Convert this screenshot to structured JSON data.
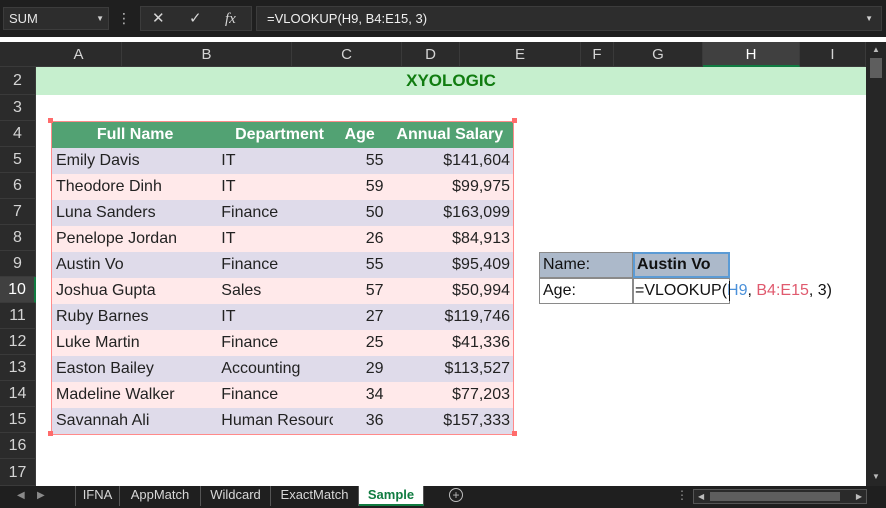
{
  "formula_bar": {
    "name_box": "SUM",
    "formula": "=VLOOKUP(H9, B4:E15, 3)",
    "cancel_glyph": "✕",
    "enter_glyph": "✓",
    "fx_glyph": "fx"
  },
  "columns": [
    "A",
    "B",
    "C",
    "D",
    "E",
    "F",
    "G",
    "H",
    "I"
  ],
  "selected_column": "H",
  "rows": [
    "2",
    "3",
    "4",
    "5",
    "6",
    "7",
    "8",
    "9",
    "10",
    "11",
    "12",
    "13",
    "14",
    "15",
    "16",
    "17"
  ],
  "selected_row": "10",
  "banner": {
    "title": "XYOLOGIC"
  },
  "table": {
    "headers": [
      "Full Name",
      "Department",
      "Age",
      "Annual Salary"
    ],
    "rows": [
      [
        "Emily Davis",
        "IT",
        "55",
        "$141,604"
      ],
      [
        "Theodore Dinh",
        "IT",
        "59",
        "$99,975"
      ],
      [
        "Luna Sanders",
        "Finance",
        "50",
        "$163,099"
      ],
      [
        "Penelope Jordan",
        "IT",
        "26",
        "$84,913"
      ],
      [
        "Austin Vo",
        "Finance",
        "55",
        "$95,409"
      ],
      [
        "Joshua Gupta",
        "Sales",
        "57",
        "$50,994"
      ],
      [
        "Ruby Barnes",
        "IT",
        "27",
        "$119,746"
      ],
      [
        "Luke Martin",
        "Finance",
        "25",
        "$41,336"
      ],
      [
        "Easton Bailey",
        "Accounting",
        "29",
        "$113,527"
      ],
      [
        "Madeline Walker",
        "Finance",
        "34",
        "$77,203"
      ],
      [
        "Savannah Ali",
        "Human Resources",
        "36",
        "$157,333"
      ]
    ]
  },
  "lookup": {
    "name_label": "Name:",
    "name_value": "Austin Vo",
    "age_label": "Age:",
    "formula_prefix": "=VLOOKUP(",
    "formula_ref1": "H9",
    "formula_sep1": ", ",
    "formula_ref2": "B4:E15",
    "formula_suffix": ", 3)"
  },
  "sheet_tabs": {
    "tabs": [
      "IFNA",
      "AppMatch",
      "Wildcard",
      "ExactMatch",
      "Sample"
    ],
    "active": "Sample",
    "add_glyph": "+"
  },
  "colors": {
    "banner_bg": "#c6efce",
    "banner_text": "#107c10",
    "table_header": "#52a273",
    "row_odd": "#dfdbea",
    "row_even": "#ffe9ea",
    "lookup_fill": "#acb9ca",
    "accent_green": "#107c41"
  }
}
